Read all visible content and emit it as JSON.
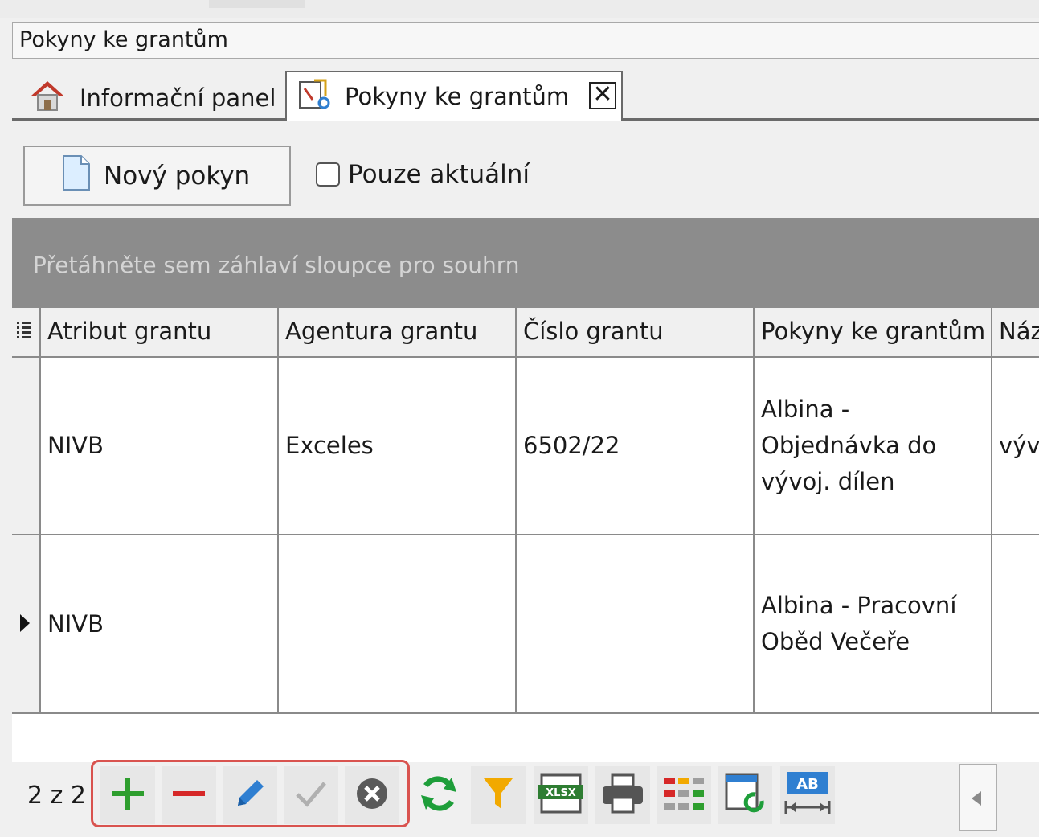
{
  "window": {
    "title": "Pokyny ke grantům"
  },
  "tabs": [
    {
      "label": "Informační panel",
      "icon": "home-icon"
    },
    {
      "label": "Pokyny ke grantům",
      "icon": "grant-notes-icon",
      "close": "✕"
    }
  ],
  "toolbar": {
    "new_label": "Nový pokyn",
    "current_only_label": "Pouze aktuální",
    "current_only_checked": false
  },
  "grid": {
    "group_hint": "Přetáhněte sem záhlaví sloupce pro souhrn",
    "columns": [
      "Atribut grantu",
      "Agentura grantu",
      "Číslo grantu",
      "Pokyny ke grantům",
      "Náz"
    ],
    "rows": [
      {
        "atribut": "NIVB",
        "agentura": "Exceles",
        "cislo": "6502/22",
        "pokyny": "Albina - Objednávka do vývoj. dílen",
        "naz": "výv"
      },
      {
        "atribut": "NIVB",
        "agentura": "",
        "cislo": "",
        "pokyny": "Albina - Pracovní Oběd Večeře",
        "naz": ""
      }
    ]
  },
  "footer": {
    "pager": "2 z 2"
  },
  "colors": {
    "add": "#2e9e2e",
    "remove": "#d62828",
    "edit": "#2f7fd1",
    "refresh": "#1e9e3a",
    "filter": "#f2a900",
    "highlight": "#d9534f",
    "group_bar": "#8c8c8c"
  }
}
